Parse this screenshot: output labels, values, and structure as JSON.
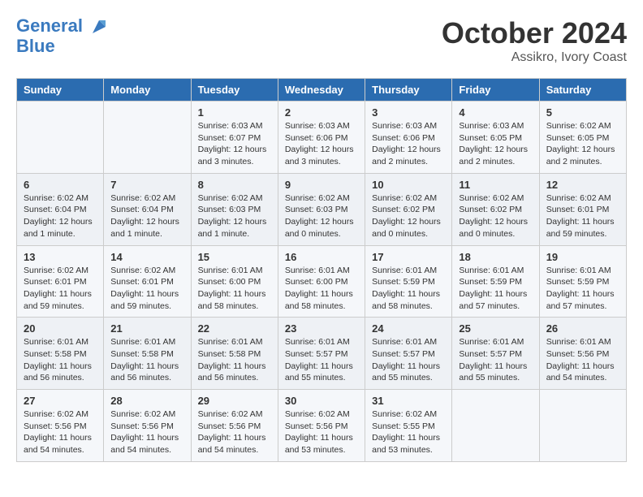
{
  "header": {
    "logo_line1": "General",
    "logo_line2": "Blue",
    "month": "October 2024",
    "location": "Assikro, Ivory Coast"
  },
  "weekdays": [
    "Sunday",
    "Monday",
    "Tuesday",
    "Wednesday",
    "Thursday",
    "Friday",
    "Saturday"
  ],
  "weeks": [
    [
      {
        "day": "",
        "content": ""
      },
      {
        "day": "",
        "content": ""
      },
      {
        "day": "1",
        "content": "Sunrise: 6:03 AM\nSunset: 6:07 PM\nDaylight: 12 hours and 3 minutes."
      },
      {
        "day": "2",
        "content": "Sunrise: 6:03 AM\nSunset: 6:06 PM\nDaylight: 12 hours and 3 minutes."
      },
      {
        "day": "3",
        "content": "Sunrise: 6:03 AM\nSunset: 6:06 PM\nDaylight: 12 hours and 2 minutes."
      },
      {
        "day": "4",
        "content": "Sunrise: 6:03 AM\nSunset: 6:05 PM\nDaylight: 12 hours and 2 minutes."
      },
      {
        "day": "5",
        "content": "Sunrise: 6:02 AM\nSunset: 6:05 PM\nDaylight: 12 hours and 2 minutes."
      }
    ],
    [
      {
        "day": "6",
        "content": "Sunrise: 6:02 AM\nSunset: 6:04 PM\nDaylight: 12 hours and 1 minute."
      },
      {
        "day": "7",
        "content": "Sunrise: 6:02 AM\nSunset: 6:04 PM\nDaylight: 12 hours and 1 minute."
      },
      {
        "day": "8",
        "content": "Sunrise: 6:02 AM\nSunset: 6:03 PM\nDaylight: 12 hours and 1 minute."
      },
      {
        "day": "9",
        "content": "Sunrise: 6:02 AM\nSunset: 6:03 PM\nDaylight: 12 hours and 0 minutes."
      },
      {
        "day": "10",
        "content": "Sunrise: 6:02 AM\nSunset: 6:02 PM\nDaylight: 12 hours and 0 minutes."
      },
      {
        "day": "11",
        "content": "Sunrise: 6:02 AM\nSunset: 6:02 PM\nDaylight: 12 hours and 0 minutes."
      },
      {
        "day": "12",
        "content": "Sunrise: 6:02 AM\nSunset: 6:01 PM\nDaylight: 11 hours and 59 minutes."
      }
    ],
    [
      {
        "day": "13",
        "content": "Sunrise: 6:02 AM\nSunset: 6:01 PM\nDaylight: 11 hours and 59 minutes."
      },
      {
        "day": "14",
        "content": "Sunrise: 6:02 AM\nSunset: 6:01 PM\nDaylight: 11 hours and 59 minutes."
      },
      {
        "day": "15",
        "content": "Sunrise: 6:01 AM\nSunset: 6:00 PM\nDaylight: 11 hours and 58 minutes."
      },
      {
        "day": "16",
        "content": "Sunrise: 6:01 AM\nSunset: 6:00 PM\nDaylight: 11 hours and 58 minutes."
      },
      {
        "day": "17",
        "content": "Sunrise: 6:01 AM\nSunset: 5:59 PM\nDaylight: 11 hours and 58 minutes."
      },
      {
        "day": "18",
        "content": "Sunrise: 6:01 AM\nSunset: 5:59 PM\nDaylight: 11 hours and 57 minutes."
      },
      {
        "day": "19",
        "content": "Sunrise: 6:01 AM\nSunset: 5:59 PM\nDaylight: 11 hours and 57 minutes."
      }
    ],
    [
      {
        "day": "20",
        "content": "Sunrise: 6:01 AM\nSunset: 5:58 PM\nDaylight: 11 hours and 56 minutes."
      },
      {
        "day": "21",
        "content": "Sunrise: 6:01 AM\nSunset: 5:58 PM\nDaylight: 11 hours and 56 minutes."
      },
      {
        "day": "22",
        "content": "Sunrise: 6:01 AM\nSunset: 5:58 PM\nDaylight: 11 hours and 56 minutes."
      },
      {
        "day": "23",
        "content": "Sunrise: 6:01 AM\nSunset: 5:57 PM\nDaylight: 11 hours and 55 minutes."
      },
      {
        "day": "24",
        "content": "Sunrise: 6:01 AM\nSunset: 5:57 PM\nDaylight: 11 hours and 55 minutes."
      },
      {
        "day": "25",
        "content": "Sunrise: 6:01 AM\nSunset: 5:57 PM\nDaylight: 11 hours and 55 minutes."
      },
      {
        "day": "26",
        "content": "Sunrise: 6:01 AM\nSunset: 5:56 PM\nDaylight: 11 hours and 54 minutes."
      }
    ],
    [
      {
        "day": "27",
        "content": "Sunrise: 6:02 AM\nSunset: 5:56 PM\nDaylight: 11 hours and 54 minutes."
      },
      {
        "day": "28",
        "content": "Sunrise: 6:02 AM\nSunset: 5:56 PM\nDaylight: 11 hours and 54 minutes."
      },
      {
        "day": "29",
        "content": "Sunrise: 6:02 AM\nSunset: 5:56 PM\nDaylight: 11 hours and 54 minutes."
      },
      {
        "day": "30",
        "content": "Sunrise: 6:02 AM\nSunset: 5:56 PM\nDaylight: 11 hours and 53 minutes."
      },
      {
        "day": "31",
        "content": "Sunrise: 6:02 AM\nSunset: 5:55 PM\nDaylight: 11 hours and 53 minutes."
      },
      {
        "day": "",
        "content": ""
      },
      {
        "day": "",
        "content": ""
      }
    ]
  ]
}
